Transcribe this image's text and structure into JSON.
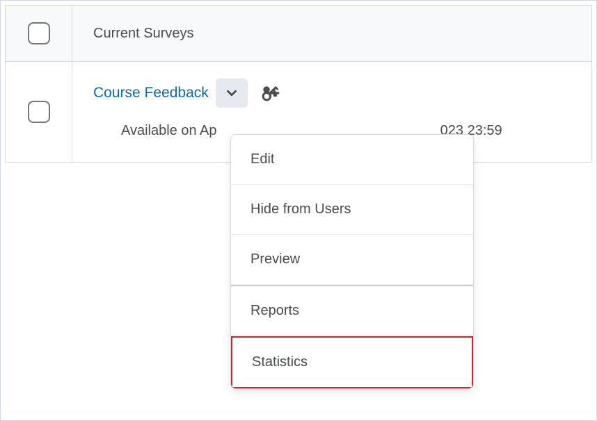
{
  "table": {
    "header_label": "Current Surveys",
    "row": {
      "survey_title": "Course Feedback",
      "availability_prefix": "Available on Ap",
      "availability_suffix": "023 23:59"
    }
  },
  "dropdown": {
    "items": {
      "edit": "Edit",
      "hide": "Hide from Users",
      "preview": "Preview",
      "reports": "Reports",
      "statistics": "Statistics"
    }
  },
  "colors": {
    "link": "#006fbf",
    "highlight_border": "#d4202d"
  }
}
